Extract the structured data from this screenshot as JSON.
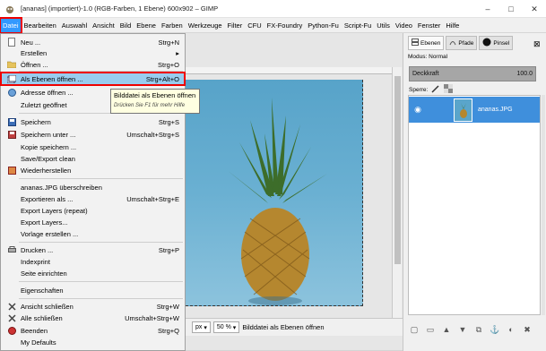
{
  "window": {
    "title": "[ananas] (importiert)-1.0 (RGB-Farben, 1 Ebene) 600x902 – GIMP",
    "minimize": "–",
    "maximize": "□",
    "close": "✕"
  },
  "menubar": {
    "items": [
      "Datei",
      "Bearbeiten",
      "Auswahl",
      "Ansicht",
      "Bild",
      "Ebene",
      "Farben",
      "Werkzeuge",
      "Filter",
      "CFU",
      "FX-Foundry",
      "Python-Fu",
      "Script-Fu",
      "Utils",
      "Video",
      "Fenster",
      "Hilfe"
    ]
  },
  "file_menu": {
    "items": [
      {
        "label": "Neu ...",
        "shortcut": "Strg+N"
      },
      {
        "label": "Erstellen",
        "shortcut": "▸"
      },
      {
        "label": "Öffnen ...",
        "shortcut": "Strg+O"
      },
      {
        "label": "Als Ebenen öffnen ...",
        "shortcut": "Strg+Alt+O"
      },
      {
        "label": "Adresse öffnen ...",
        "shortcut": ""
      },
      {
        "label": "Zuletzt geöffnet",
        "shortcut": ""
      },
      {
        "label": "Speichern",
        "shortcut": "Strg+S"
      },
      {
        "label": "Speichern unter ...",
        "shortcut": "Umschalt+Strg+S"
      },
      {
        "label": "Kopie speichern ...",
        "shortcut": ""
      },
      {
        "label": "Save/Export clean",
        "shortcut": ""
      },
      {
        "label": "Wiederherstellen",
        "shortcut": ""
      },
      {
        "label": "ananas.JPG überschreiben",
        "shortcut": ""
      },
      {
        "label": "Exportieren als ...",
        "shortcut": "Umschalt+Strg+E"
      },
      {
        "label": "Export Layers (repeat)",
        "shortcut": ""
      },
      {
        "label": "Export Layers...",
        "shortcut": ""
      },
      {
        "label": "Vorlage erstellen ...",
        "shortcut": ""
      },
      {
        "label": "Drucken ...",
        "shortcut": "Strg+P"
      },
      {
        "label": "Indexprint",
        "shortcut": ""
      },
      {
        "label": "Seite einrichten",
        "shortcut": ""
      },
      {
        "label": "Eigenschaften",
        "shortcut": ""
      },
      {
        "label": "Ansicht schließen",
        "shortcut": "Strg+W"
      },
      {
        "label": "Alle schließen",
        "shortcut": "Umschalt+Strg+W"
      },
      {
        "label": "Beenden",
        "shortcut": "Strg+Q"
      },
      {
        "label": "My Defaults",
        "shortcut": ""
      }
    ]
  },
  "tooltip": {
    "title": "Bilddatei als Ebenen öffnen",
    "hint": "Drücken Sie F1 für mehr Hilfe"
  },
  "statusbar": {
    "unit": "px",
    "zoom": "50 %",
    "message": "Bilddatei als Ebenen öffnen"
  },
  "layers_panel": {
    "tabs": [
      "Ebenen",
      "Pfade",
      "Pinsel"
    ],
    "mode_label": "Modus: Normal",
    "opacity_label": "Deckkraft",
    "opacity_value": "100.0",
    "lock_label": "Sperre:",
    "layer_name": "ananas.JPG"
  },
  "colors": {
    "highlight": "#99ccee",
    "menu_active": "#3399ff",
    "callout_red": "#e00000",
    "layer_selected": "#3f8fdc"
  }
}
